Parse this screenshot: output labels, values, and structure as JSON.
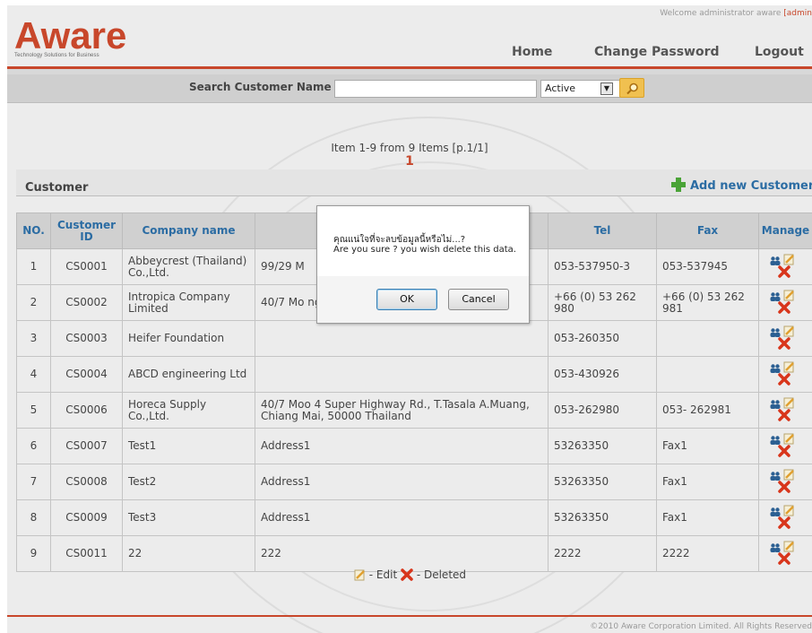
{
  "header": {
    "logo_text": "Aware",
    "logo_tagline": "Technology Solutions for Business",
    "welcome_text": "Welcome administrator aware",
    "welcome_user": "[admin",
    "nav": {
      "home": "Home",
      "change_password": "Change Password",
      "logout": "Logout"
    }
  },
  "search": {
    "label": "Search Customer Name",
    "input_value": "",
    "status_selected": "Active"
  },
  "pagination": {
    "info": "Item 1-9 from 9 Items [p.1/1]",
    "current_page": "1"
  },
  "section": {
    "title": "Customer",
    "add_label": "Add new Customer"
  },
  "table": {
    "columns": [
      "NO.",
      "Customer ID",
      "Company name",
      "",
      "Tel",
      "Fax",
      "Manage"
    ],
    "rows": [
      {
        "no": "1",
        "id": "CS0001",
        "company": "Abbeycrest (Thailand) Co.,Ltd.",
        "address": "99/29 M",
        "tel": "053-537950-3",
        "fax": "053-537945"
      },
      {
        "no": "2",
        "id": "CS0002",
        "company": "Intropica Company Limited",
        "address": "40/7 Mo                    ng 50000 Ch",
        "tel": "+66 (0) 53 262 980",
        "fax": "+66 (0) 53 262 981"
      },
      {
        "no": "3",
        "id": "CS0003",
        "company": "Heifer Foundation",
        "address": "",
        "tel": "053-260350",
        "fax": ""
      },
      {
        "no": "4",
        "id": "CS0004",
        "company": "ABCD engineering Ltd",
        "address": "",
        "tel": "053-430926",
        "fax": ""
      },
      {
        "no": "5",
        "id": "CS0006",
        "company": "Horeca Supply Co.,Ltd.",
        "address": "40/7 Moo 4 Super Highway Rd., T.Tasala A.Muang, Chiang Mai, 50000 Thailand",
        "tel": "053-262980",
        "fax": "053- 262981"
      },
      {
        "no": "6",
        "id": "CS0007",
        "company": "Test1",
        "address": "Address1",
        "tel": "53263350",
        "fax": "Fax1"
      },
      {
        "no": "7",
        "id": "CS0008",
        "company": "Test2",
        "address": "Address1",
        "tel": "53263350",
        "fax": "Fax1"
      },
      {
        "no": "8",
        "id": "CS0009",
        "company": "Test3",
        "address": "Address1",
        "tel": "53263350",
        "fax": "Fax1"
      },
      {
        "no": "9",
        "id": "CS0011",
        "company": "22",
        "address": "222",
        "tel": "2222",
        "fax": "2222"
      }
    ]
  },
  "legend": {
    "edit": "- Edit",
    "deleted": "- Deleted"
  },
  "footer": {
    "copyright": "©2010 Aware Corporation Limited. All Rights Reserved"
  },
  "dialog": {
    "message_thai": "คุณแน่ใจที่จะลบข้อมูลนี้หรือไม่...?",
    "message_en": "Are you sure ? you wish delete this data.",
    "ok_label": "OK",
    "cancel_label": "Cancel"
  },
  "icons": {
    "search": "magnifier-icon",
    "add": "plus-icon",
    "users": "users-icon",
    "edit": "pencil-icon",
    "delete": "red-x-icon"
  },
  "colors": {
    "brand": "#c8472b",
    "header_text": "#2b6ca3",
    "add_plus": "#4aa337"
  }
}
